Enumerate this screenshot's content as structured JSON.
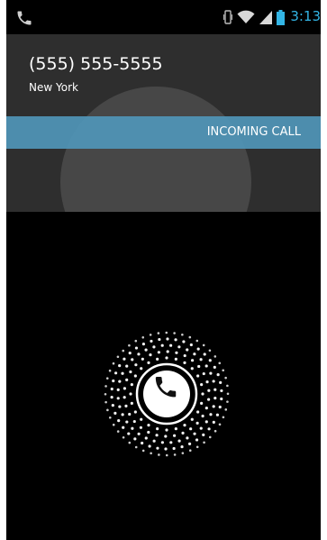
{
  "status_bar": {
    "time": "3:13",
    "icons": [
      "phone-icon",
      "vibrate-icon",
      "wifi-icon",
      "signal-icon",
      "battery-icon"
    ],
    "time_color": "#33b5e5"
  },
  "caller": {
    "number": "(555) 555-5555",
    "location": "New York"
  },
  "call_state": {
    "label": "INCOMING CALL",
    "bar_color": "#5096b9"
  },
  "answer_control": {
    "icon": "phone-icon"
  }
}
